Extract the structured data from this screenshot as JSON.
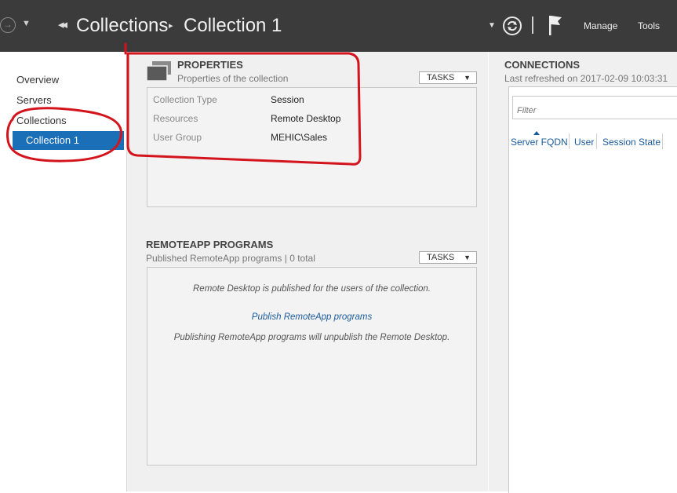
{
  "titlebar": {
    "crumb1": "Collections",
    "crumb2": "Collection 1",
    "manage": "Manage",
    "tools": "Tools",
    "icons": [
      "back-arrow-icon",
      "dropdown-icon",
      "breadcrumb-arrows-icon",
      "refresh-icon",
      "flag-icon"
    ]
  },
  "leftnav": {
    "items": [
      "Overview",
      "Servers",
      "Collections"
    ],
    "selected": "Collection 1"
  },
  "properties": {
    "title": "PROPERTIES",
    "subtitle": "Properties of the collection",
    "tasks": "TASKS",
    "rows": [
      {
        "label": "Collection Type",
        "value": "Session"
      },
      {
        "label": "Resources",
        "value": "Remote Desktop"
      },
      {
        "label": "User Group",
        "value": "MEHIC\\Sales"
      }
    ]
  },
  "remoteapp": {
    "title": "REMOTEAPP PROGRAMS",
    "subtitle": "Published RemoteApp programs | 0 total",
    "tasks": "TASKS",
    "line1": "Remote Desktop is published for the users of the collection.",
    "link": "Publish RemoteApp programs",
    "line2": "Publishing RemoteApp programs will unpublish the Remote Desktop."
  },
  "connections": {
    "title": "CONNECTIONS",
    "subtitle": "Last refreshed on 2017-02-09 10:03:31",
    "filter_placeholder": "Filter",
    "columns": [
      "Server FQDN",
      "User",
      "Session State"
    ]
  },
  "colors": {
    "titlebar": "#3b3b3b",
    "selection": "#1a6fb7",
    "annotation": "#d4141c",
    "link": "#1a5a9a"
  }
}
